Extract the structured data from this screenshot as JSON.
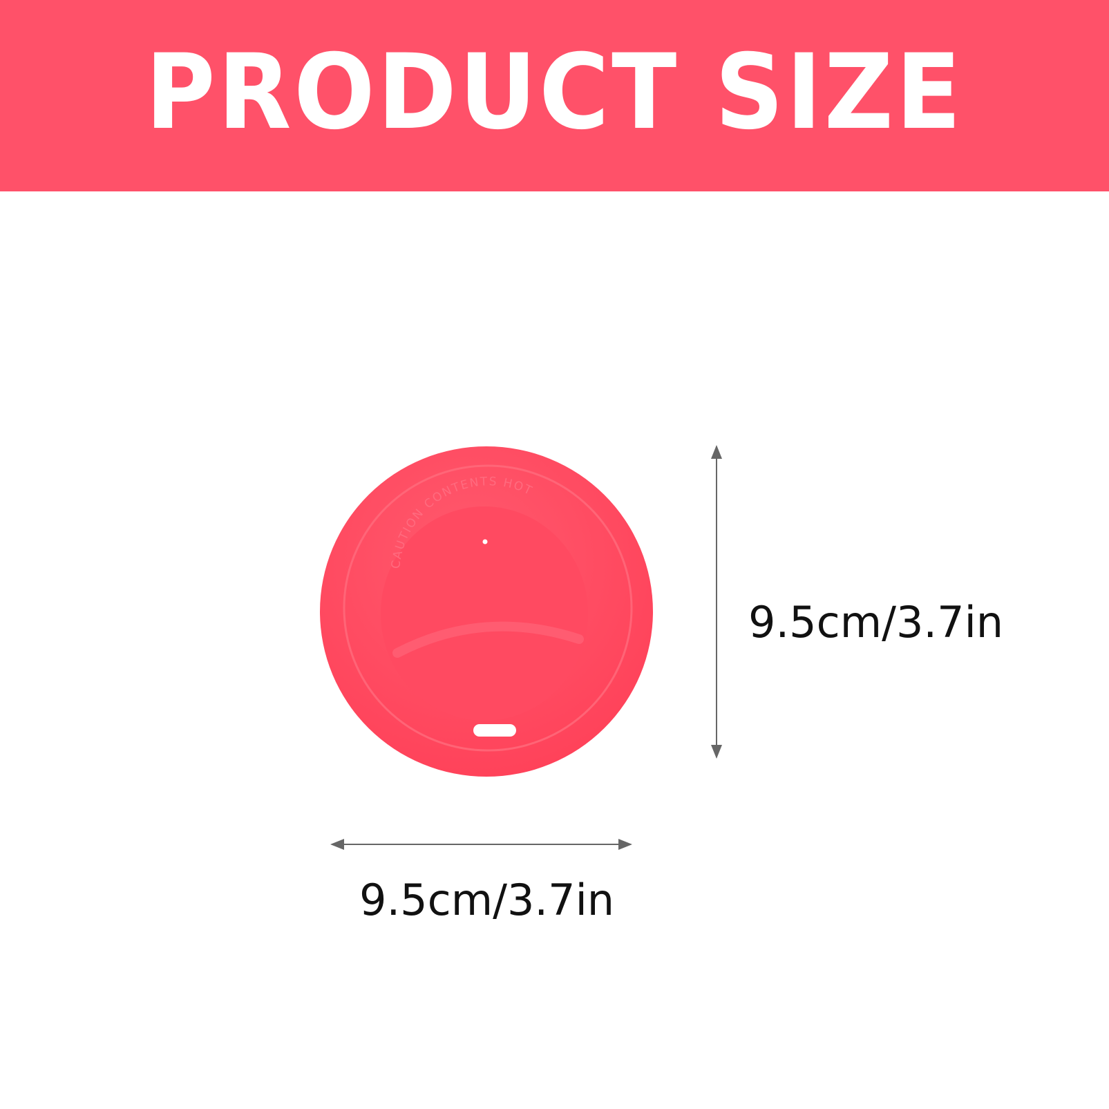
{
  "banner": {
    "title": "PRODUCT SIZE",
    "color": "#ff5169"
  },
  "product": {
    "name_icon": "silicone-cup-lid",
    "color": "#ff4a60",
    "embossed_text": "CAUTION CONTENTS HOT"
  },
  "dimensions": {
    "height_label": "9.5cm/3.7in",
    "width_label": "9.5cm/3.7in"
  }
}
